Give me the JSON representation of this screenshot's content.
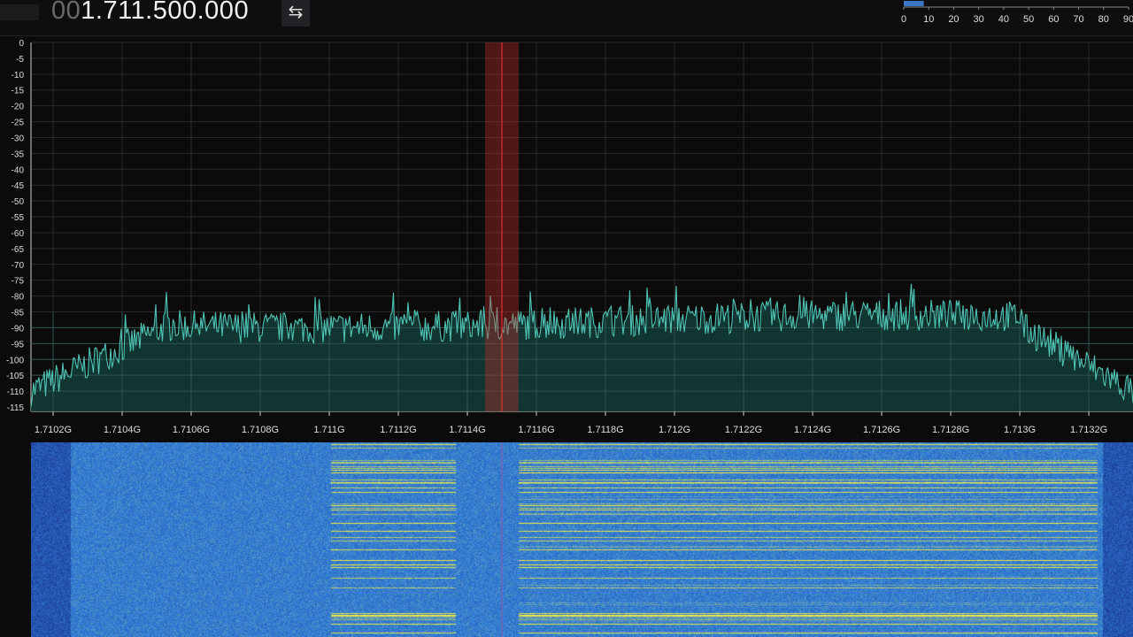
{
  "frequency": {
    "leading_zeros": "00",
    "value": "1.711.500.000"
  },
  "swap_button": {
    "icon": "swap-arrows-icon",
    "glyph": "⇆"
  },
  "snr_meter": {
    "ticks": [
      "0",
      "10",
      "20",
      "30",
      "40",
      "50",
      "60",
      "70",
      "80",
      "90"
    ],
    "level": 8,
    "max": 90,
    "color": "#3a78c4"
  },
  "spectrum": {
    "y_ticks": [
      "0",
      "-5",
      "-10",
      "-15",
      "-20",
      "-25",
      "-30",
      "-35",
      "-40",
      "-45",
      "-50",
      "-55",
      "-60",
      "-65",
      "-70",
      "-75",
      "-80",
      "-85",
      "-90",
      "-95",
      "-100",
      "-105",
      "-110",
      "-115"
    ],
    "x_ticks": [
      "1.7102G",
      "1.7104G",
      "1.7106G",
      "1.7108G",
      "1.711G",
      "1.7112G",
      "1.7114G",
      "1.7116G",
      "1.7118G",
      "1.712G",
      "1.7122G",
      "1.7124G",
      "1.7126G",
      "1.7128G",
      "1.713G",
      "1.7132G"
    ],
    "trace_color": "#4fc3b4",
    "fill_color": "#123a34",
    "vfo_color": "#c0302a"
  }
}
